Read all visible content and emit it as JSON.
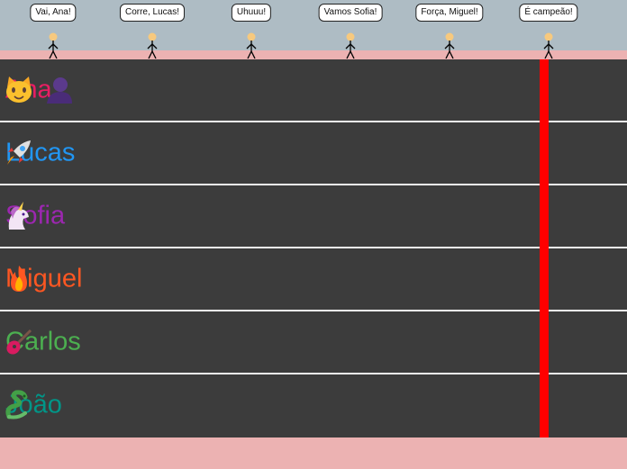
{
  "spectators": [
    {
      "cheer": "Vai, Ana!"
    },
    {
      "cheer": "Corre, Lucas!"
    },
    {
      "cheer": "Uhuuu!"
    },
    {
      "cheer": "Vamos Sofia!"
    },
    {
      "cheer": "Força, Miguel!"
    },
    {
      "cheer": "É campeão!"
    }
  ],
  "racers": [
    {
      "name": "Ana",
      "token": "cat-face-icon",
      "color": "#e91e63"
    },
    {
      "name": "Lucas",
      "token": "rocket-icon",
      "color": "#2196f3"
    },
    {
      "name": "Sofia",
      "token": "unicorn-icon",
      "color": "#9c27b0"
    },
    {
      "name": "Miguel",
      "token": "fire-icon",
      "color": "#ff5722"
    },
    {
      "name": "Carlos",
      "token": "guitar-icon",
      "color": "#4caf50"
    },
    {
      "name": "João",
      "token": "dragon-icon",
      "color": "#009688"
    }
  ],
  "colors": {
    "sky": "#aebcc4",
    "track": "#3c3c3c",
    "finish_line": "#ff0000",
    "ground": "#ecb2b2"
  }
}
